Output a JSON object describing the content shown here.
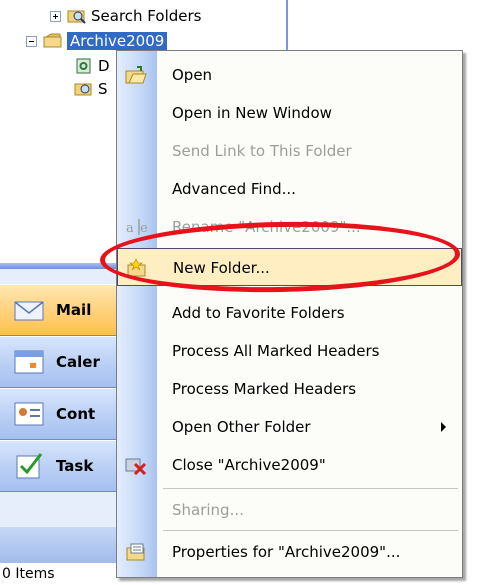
{
  "tree": {
    "search_folders": "Search Folders",
    "archive": "Archive2009",
    "partial_1": "D",
    "partial_2": "S"
  },
  "nav": {
    "mail": "Mail",
    "calendar": "Caler",
    "contacts": "Cont",
    "tasks": "Task"
  },
  "status": {
    "items": "0 Items"
  },
  "menu": {
    "open": "Open",
    "open_new_window": "Open in New Window",
    "send_link": "Send Link to This Folder",
    "advanced_find": "Advanced Find...",
    "rename": "Rename \"Archive2009\"...",
    "new_folder": "New Folder...",
    "add_favorite": "Add to Favorite Folders",
    "process_all": "Process All Marked Headers",
    "process_marked": "Process Marked Headers",
    "open_other": "Open Other Folder",
    "close": "Close \"Archive2009\"",
    "sharing": "Sharing...",
    "properties": "Properties for \"Archive2009\"..."
  },
  "colors": {
    "highlight": "#ffeec2",
    "annotation": "#e8121b",
    "selected": "#316ac5"
  }
}
